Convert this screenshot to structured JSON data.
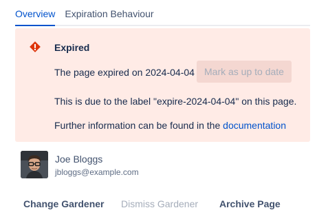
{
  "tabs": [
    {
      "label": "Overview",
      "selected": true
    },
    {
      "label": "Expiration Behaviour",
      "selected": false
    }
  ],
  "alert": {
    "icon": "error-icon",
    "accent_color": "#de350b",
    "background_color": "#ffebe6",
    "title": "Expired",
    "expired_prefix": "The page expired on ",
    "expired_date": "2024-04-04",
    "mark_button": "Mark as up to date",
    "reason": "This is due to the label \"expire-2024-04-04\" on this page.",
    "info_prefix": "Further information can be found in the ",
    "info_link": "documentation"
  },
  "gardener": {
    "name": "Joe Bloggs",
    "email": "jbloggs@example.com"
  },
  "actions": {
    "change": "Change Gardener",
    "dismiss": "Dismiss Gardener",
    "archive": "Archive Page"
  }
}
